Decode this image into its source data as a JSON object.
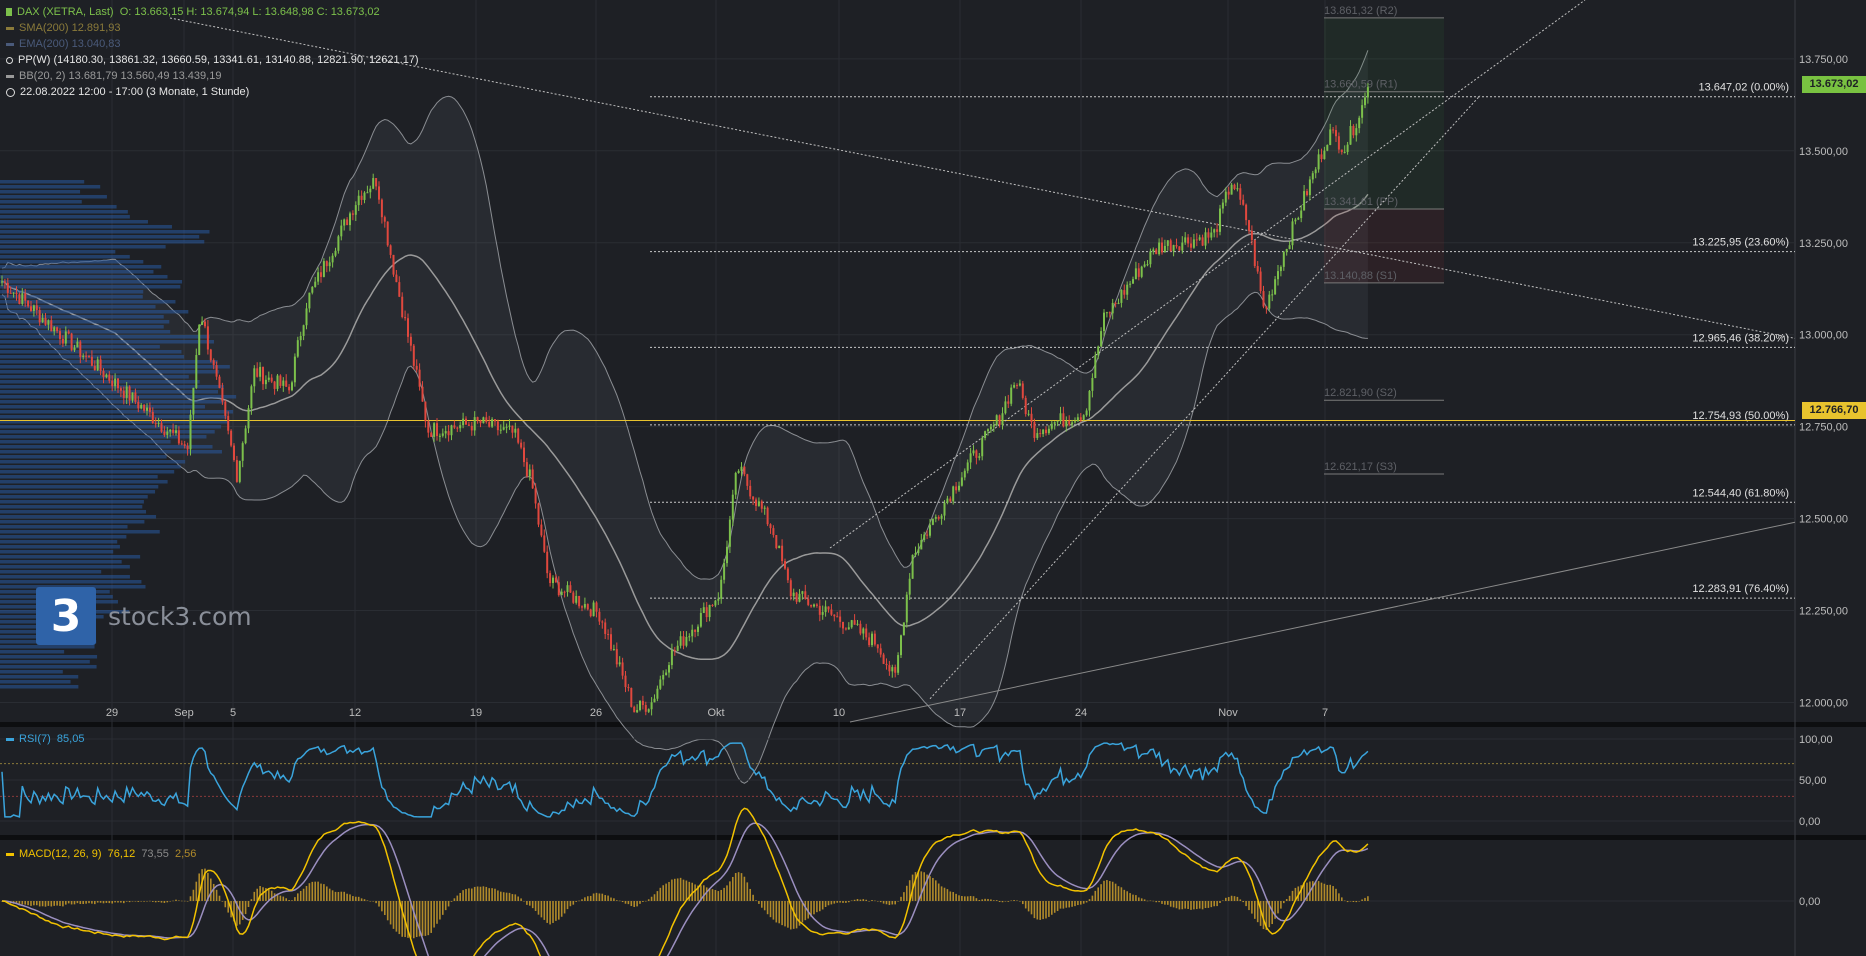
{
  "colors": {
    "background": "#1e2025",
    "up": "#7cc04b",
    "down": "#e0483e",
    "bollinger": "#8a8d92",
    "sma": "#9a9a9a",
    "rsi": "#3aa4dc",
    "macd": "#f2c200",
    "signal": "#9b8fc0",
    "fib_level": "#d8d8d8",
    "price_tag": "#79c241",
    "level_tag": "#e8c32e"
  },
  "legend": {
    "main": "DAX (XETRA, Last)",
    "ohlc": "O: 13.663,15  H: 13.674,94  L: 13.648,98  C: 13.673,02",
    "sma": "SMA(200)  12.891,93",
    "ema": "EMA(200)  13.040,83",
    "pp": "PP(W)  (14180.30, 13861.32, 13660.59, 13341.61, 13140.88, 12821.90, 12621.17)",
    "bb": "BB(20, 2)  13.681,79  13.560,49  13.439,19",
    "period": "22.08.2022 12:00 - 17:00   (3 Monate, 1 Stunde)"
  },
  "price_axis_labels": [
    "13.750,00",
    "13.500,00",
    "13.250,00",
    "13.000,00",
    "12.750,00",
    "12.500,00",
    "12.250,00",
    "12.000,00"
  ],
  "price_tags": {
    "current": "13.673,02",
    "level": "12.766,70"
  },
  "fib_labels": [
    "13.647,02 (0.00%)",
    "13.225,95 (23.60%)",
    "12.965,46 (38.20%)",
    "12.754,93 (50.00%)",
    "12.544,40 (61.80%)",
    "12.283,91 (76.40%)"
  ],
  "pivot_labels": [
    "13.861,32 (R2)",
    "13.660,59 (R1)",
    "13.341,61 (PP)",
    "13.140,88 (S1)",
    "12.821,90 (S2)",
    "12.621,17 (S3)"
  ],
  "x_axis_labels": [
    "29",
    "Sep",
    "5",
    "12",
    "19",
    "26",
    "Okt",
    "10",
    "17",
    "24",
    "Nov",
    "7"
  ],
  "rsi": {
    "label": "RSI(7)",
    "value": "85,05",
    "axis": [
      "100,00",
      "50,00",
      "0,00"
    ]
  },
  "macd": {
    "label": "MACD(12, 26, 9)",
    "value": "76,12",
    "signal": "73,55",
    "hist": "2,56",
    "axis": [
      "0,00"
    ]
  },
  "watermark": {
    "logo": "3",
    "text": "stock3.com"
  },
  "chart_data": [
    {
      "type": "candlestick",
      "title": "DAX (XETRA, Last)",
      "timeframe": "1 Stunde",
      "x_labels": [
        "29",
        "Sep",
        "5",
        "12",
        "19",
        "26",
        "Okt",
        "10",
        "17",
        "24",
        "Nov",
        "7"
      ],
      "ylim": [
        11950,
        13950
      ],
      "close_path": [
        [
          "29 Aug",
          13150
        ],
        [
          "01 Sep",
          12690
        ],
        [
          "02 Sep",
          13070
        ],
        [
          "05 Sep",
          12620
        ],
        [
          "06 Sep",
          12900
        ],
        [
          "08 Sep",
          12850
        ],
        [
          "09 Sep",
          13090
        ],
        [
          "12 Sep",
          13380
        ],
        [
          "13 Sep",
          13420
        ],
        [
          "14 Sep",
          13180
        ],
        [
          "16 Sep",
          12740
        ],
        [
          "19 Sep",
          12760
        ],
        [
          "21 Sep",
          12730
        ],
        [
          "22 Sep",
          12600
        ],
        [
          "23 Sep",
          12330
        ],
        [
          "26 Sep",
          12240
        ],
        [
          "28 Sep",
          11980
        ],
        [
          "29 Sep",
          12000
        ],
        [
          "30 Sep",
          12120
        ],
        [
          "03 Okt",
          12300
        ],
        [
          "04 Okt",
          12640
        ],
        [
          "06 Okt",
          12470
        ],
        [
          "07 Okt",
          12300
        ],
        [
          "10 Okt",
          12220
        ],
        [
          "12 Okt",
          12160
        ],
        [
          "13 Okt",
          12060
        ],
        [
          "14 Okt",
          12400
        ],
        [
          "17 Okt",
          12630
        ],
        [
          "19 Okt",
          12770
        ],
        [
          "20 Okt",
          12880
        ],
        [
          "21 Okt",
          12740
        ],
        [
          "24 Okt",
          12790
        ],
        [
          "25 Okt",
          13040
        ],
        [
          "27 Okt",
          13180
        ],
        [
          "28 Okt",
          13240
        ],
        [
          "31 Okt",
          13270
        ],
        [
          "01 Nov",
          13420
        ],
        [
          "02 Nov",
          13300
        ],
        [
          "03 Nov",
          13060
        ],
        [
          "04 Nov",
          13200
        ],
        [
          "07 Nov",
          13550
        ],
        [
          "08 Nov",
          13510
        ],
        [
          "09 Nov",
          13673.02
        ]
      ],
      "last": {
        "open": 13663.15,
        "high": 13674.94,
        "low": 13648.98,
        "close": 13673.02
      },
      "bollinger": {
        "period": 20,
        "mult": 2,
        "upper": 13681.79,
        "middle": 13560.49,
        "lower": 13439.19
      },
      "fibonacci": [
        {
          "pct": 0.0,
          "price": 13647.02
        },
        {
          "pct": 23.6,
          "price": 13225.95
        },
        {
          "pct": 38.2,
          "price": 12965.46
        },
        {
          "pct": 50.0,
          "price": 12754.93
        },
        {
          "pct": 61.8,
          "price": 12544.4
        },
        {
          "pct": 76.4,
          "price": 12283.91
        }
      ],
      "pivots_weekly": [
        14180.3,
        13861.32,
        13660.59,
        13341.61,
        13140.88,
        12821.9,
        12621.17
      ]
    },
    {
      "type": "line",
      "title": "RSI(7)",
      "ylim": [
        -10,
        110
      ],
      "last": 85.05
    },
    {
      "type": "line",
      "title": "MACD(12, 26, 9)",
      "macd": 76.12,
      "signal": 73.55,
      "histogram": 2.56
    }
  ]
}
